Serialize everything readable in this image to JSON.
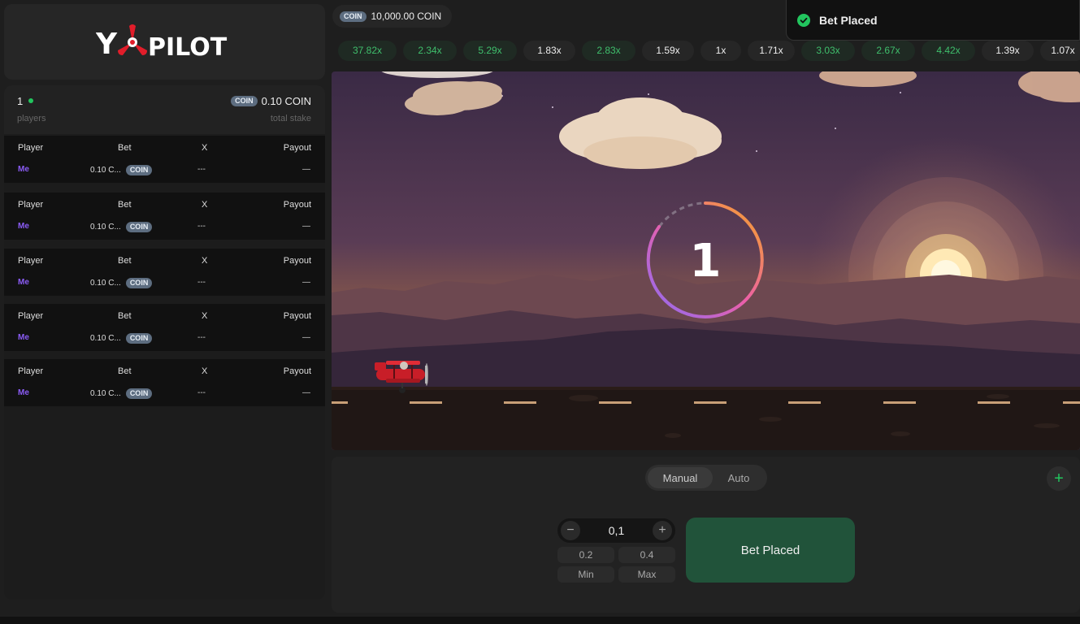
{
  "brand": {
    "logo_text": "YOPILOT"
  },
  "balance": {
    "currency_badge": "COIN",
    "amount": "10,000.00 COIN"
  },
  "notification": {
    "text": "Bet Placed"
  },
  "history": [
    {
      "value": "37.82x",
      "color": "green"
    },
    {
      "value": "2.34x",
      "color": "green"
    },
    {
      "value": "5.29x",
      "color": "green"
    },
    {
      "value": "1.83x",
      "color": "white"
    },
    {
      "value": "2.83x",
      "color": "green"
    },
    {
      "value": "1.59x",
      "color": "white"
    },
    {
      "value": "1x",
      "color": "white"
    },
    {
      "value": "1.71x",
      "color": "white"
    },
    {
      "value": "3.03x",
      "color": "green"
    },
    {
      "value": "2.67x",
      "color": "green"
    },
    {
      "value": "4.42x",
      "color": "green"
    },
    {
      "value": "1.39x",
      "color": "white"
    },
    {
      "value": "1.07x",
      "color": "white"
    }
  ],
  "summary": {
    "players_count": "1",
    "players_label": "players",
    "stake_badge": "COIN",
    "stake_value": "0.10 COIN",
    "stake_label": "total stake"
  },
  "bet_tables": [
    {
      "headers": {
        "player": "Player",
        "bet": "Bet",
        "x": "X",
        "payout": "Payout"
      },
      "row": {
        "player": "Me",
        "bet": "0.10 C...",
        "badge": "COIN",
        "x": "---",
        "payout": "—"
      }
    },
    {
      "headers": {
        "player": "Player",
        "bet": "Bet",
        "x": "X",
        "payout": "Payout"
      },
      "row": {
        "player": "Me",
        "bet": "0.10 C...",
        "badge": "COIN",
        "x": "---",
        "payout": "—"
      }
    },
    {
      "headers": {
        "player": "Player",
        "bet": "Bet",
        "x": "X",
        "payout": "Payout"
      },
      "row": {
        "player": "Me",
        "bet": "0.10 C...",
        "badge": "COIN",
        "x": "---",
        "payout": "—"
      }
    },
    {
      "headers": {
        "player": "Player",
        "bet": "Bet",
        "x": "X",
        "payout": "Payout"
      },
      "row": {
        "player": "Me",
        "bet": "0.10 C...",
        "badge": "COIN",
        "x": "---",
        "payout": "—"
      }
    },
    {
      "headers": {
        "player": "Player",
        "bet": "Bet",
        "x": "X",
        "payout": "Payout"
      },
      "row": {
        "player": "Me",
        "bet": "0.10 C...",
        "badge": "COIN",
        "x": "---",
        "payout": "—"
      }
    }
  ],
  "game": {
    "countdown": "1"
  },
  "controls": {
    "mode_manual": "Manual",
    "mode_auto": "Auto",
    "add_label": "+",
    "minus_label": "−",
    "plus_label": "+",
    "bet_amount": "0,1",
    "quick_1": "0.2",
    "quick_2": "0.4",
    "quick_min": "Min",
    "quick_max": "Max",
    "bet_button": "Bet Placed"
  },
  "colors": {
    "accent_green": "#22c55e",
    "button_green": "#21533a",
    "player_purple": "#8b5cf6"
  }
}
